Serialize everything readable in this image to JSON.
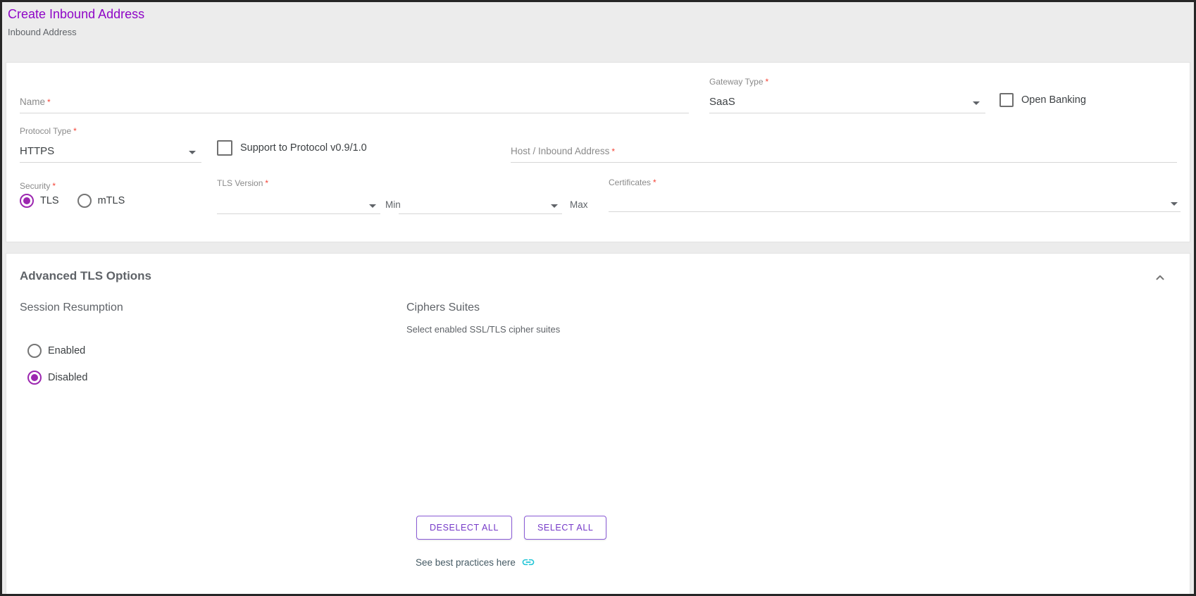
{
  "header": {
    "title": "Create Inbound Address",
    "subtitle": "Inbound Address"
  },
  "required_marker": "*",
  "basic": {
    "name_label": "Name",
    "name_value": "",
    "gateway_type": {
      "label": "Gateway Type",
      "value": "SaaS"
    },
    "open_banking_label": "Open Banking",
    "open_banking_checked": false,
    "protocol_type": {
      "label": "Protocol Type",
      "value": "HTTPS"
    },
    "support_protocol_label": "Support to Protocol v0.9/1.0",
    "support_protocol_checked": false,
    "host_label": "Host / Inbound Address",
    "host_value": "",
    "security": {
      "label": "Security",
      "options": [
        "TLS",
        "mTLS"
      ],
      "selected": "TLS"
    },
    "tls_version": {
      "label": "TLS Version",
      "min_caption": "Min",
      "max_caption": "Max",
      "min_value": "",
      "max_value": ""
    },
    "certificates_label": "Certificates",
    "certificates_value": ""
  },
  "advanced": {
    "title": "Advanced TLS Options",
    "collapsed": false,
    "session_resumption": {
      "title": "Session Resumption",
      "options": [
        "Enabled",
        "Disabled"
      ],
      "selected": "Disabled"
    },
    "ciphers": {
      "title": "Ciphers Suites",
      "subtitle": "Select enabled SSL/TLS cipher suites"
    },
    "buttons": {
      "deselect_all": "DESELECT ALL",
      "select_all": "SELECT ALL"
    },
    "best_practices_text": "See best practices here"
  },
  "colors": {
    "title_purple": "#8f06c7",
    "accent_purple": "#9c27b0",
    "button_purple": "#7539c8",
    "link_cyan": "#1fc4d6",
    "link_text": "#455a64",
    "required_red": "#f44336",
    "page_background": "#ececec",
    "card_background": "#ffffff"
  }
}
